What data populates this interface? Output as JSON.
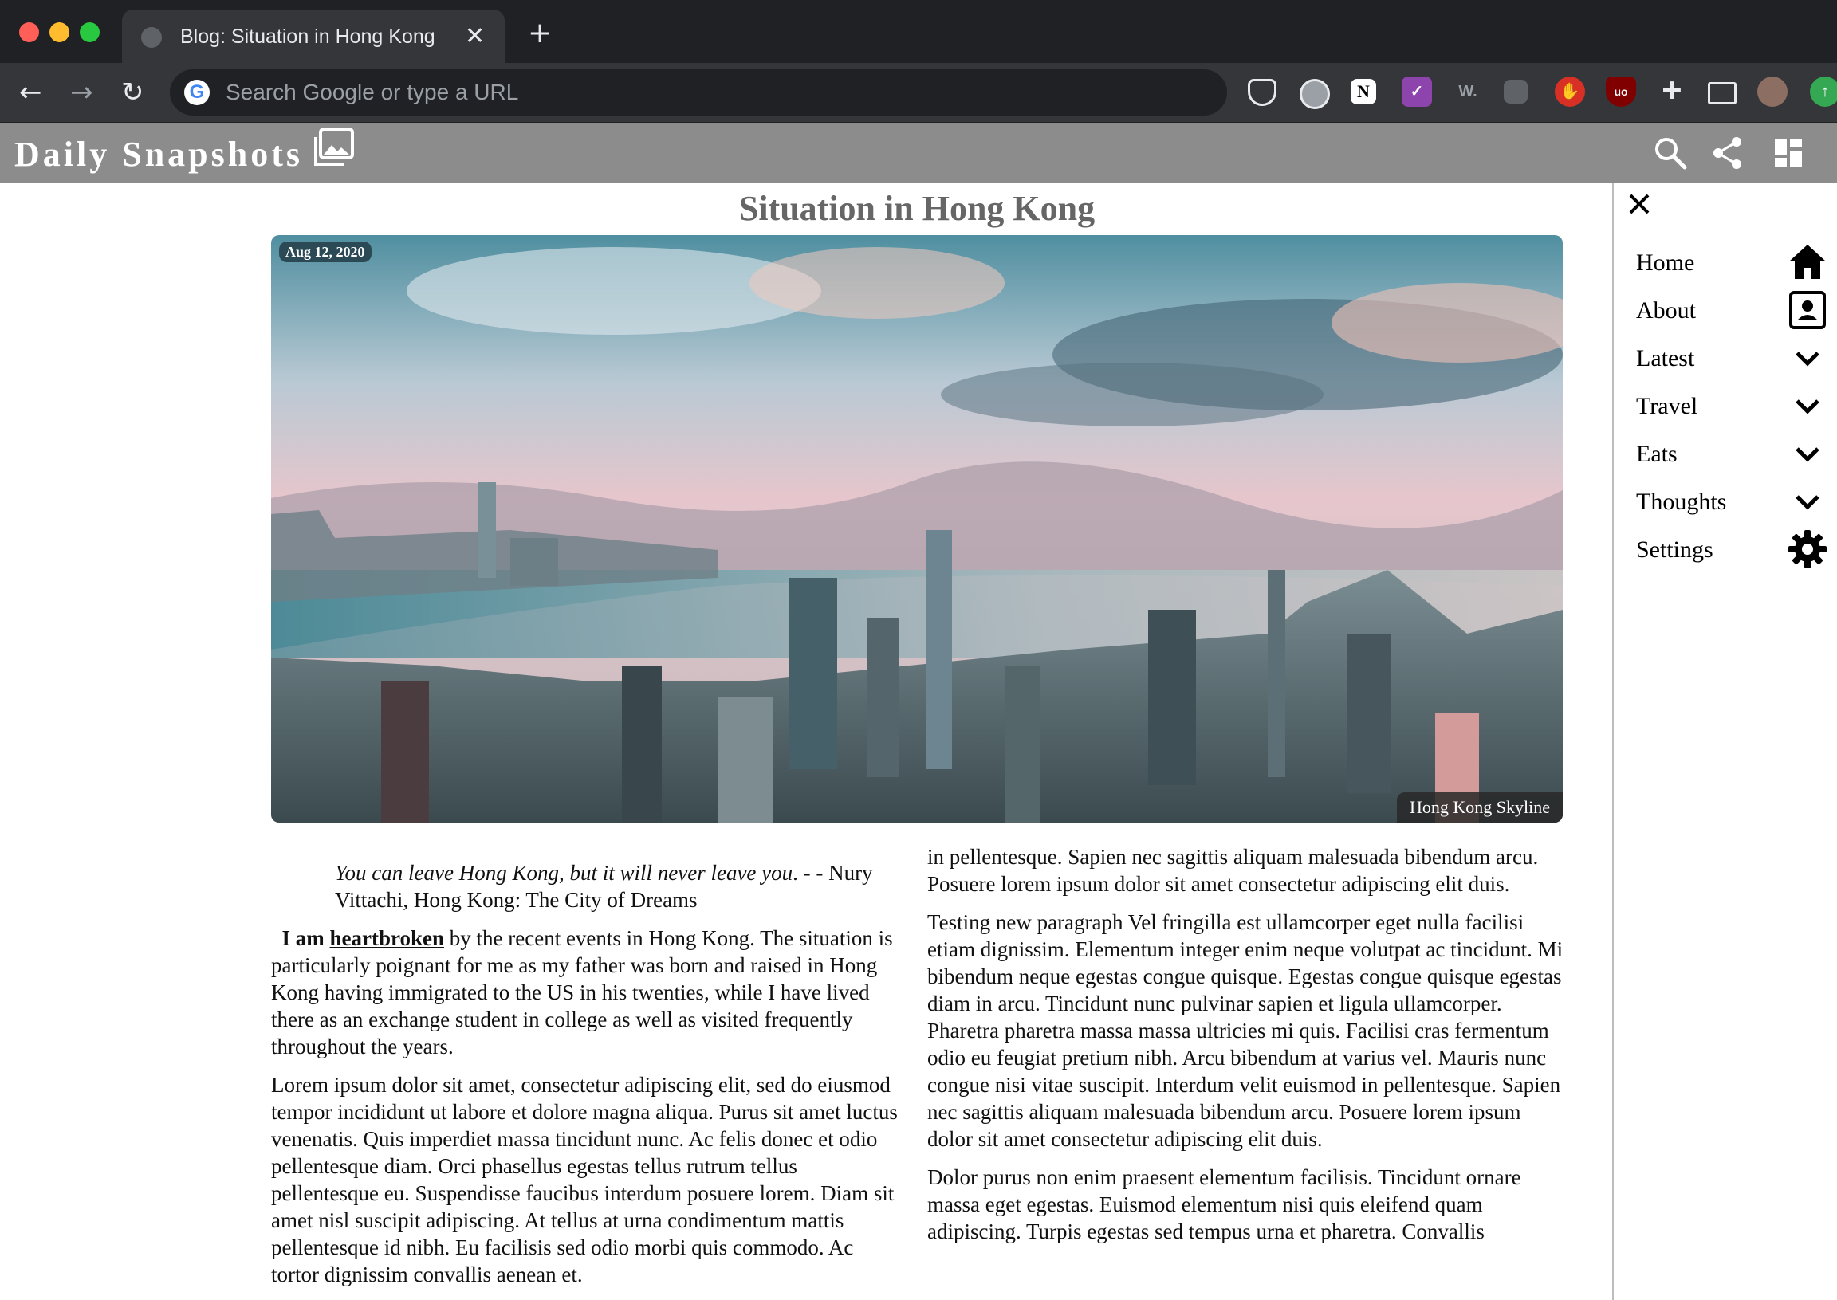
{
  "browser": {
    "tab_title": "Blog: Situation in Hong Kong",
    "omnibox_placeholder": "Search Google or type a URL",
    "extensions": [
      "pocket-icon",
      "circle-extension-icon",
      "notion-icon",
      "checklist-icon",
      "wordtune-icon",
      "office-icon",
      "stop-hand-icon",
      "ublock-icon",
      "puzzle-icon",
      "cast-icon",
      "profile-avatar",
      "update-icon"
    ]
  },
  "site": {
    "brand": "Daily Snapshots"
  },
  "article": {
    "title": "Situation in Hong Kong",
    "date": "Aug 12, 2020",
    "image_caption": "Hong Kong Skyline",
    "quote": {
      "text": "You can leave Hong Kong, but it will never leave you",
      "attribution": ". - - Nury Vittachi, Hong Kong: The City of Dreams"
    },
    "intro": {
      "lead": "I am",
      "link": "heartbroken",
      "rest": " by the recent events in Hong Kong. The situation is particularly poignant for me as my father was born and raised in Hong Kong having immigrated to the US in his twenties, while I have lived there as an exchange student in college as well as visited frequently throughout the years."
    },
    "left_paragraph": "Lorem ipsum dolor sit amet, consectetur adipiscing elit, sed do eiusmod tempor incididunt ut labore et dolore magna aliqua. Purus sit amet luctus venenatis. Quis imperdiet massa tincidunt nunc. Ac felis donec et odio pellentesque diam. Orci phasellus egestas tellus rutrum tellus pellentesque eu. Suspendisse faucibus interdum posuere lorem. Diam sit amet nisl suscipit adipiscing. At tellus at urna condimentum mattis pellentesque id nibh. Eu facilisis sed odio morbi quis commodo. Ac tortor dignissim convallis aenean et.",
    "right_paragraphs": [
      "in pellentesque. Sapien nec sagittis aliquam malesuada bibendum arcu. Posuere lorem ipsum dolor sit amet consectetur adipiscing elit duis.",
      "Testing new paragraph Vel fringilla est ullamcorper eget nulla facilisi etiam dignissim. Elementum integer enim neque volutpat ac tincidunt. Mi bibendum neque egestas congue quisque. Egestas congue quisque egestas diam in arcu. Tincidunt nunc pulvinar sapien et ligula ullamcorper. Pharetra pharetra massa massa ultricies mi quis. Facilisi cras fermentum odio eu feugiat pretium nibh. Arcu bibendum at varius vel. Mauris nunc congue nisi vitae suscipit. Interdum velit euismod in pellentesque. Sapien nec sagittis aliquam malesuada bibendum arcu. Posuere lorem ipsum dolor sit amet consectetur adipiscing elit duis.",
      "Dolor purus non enim praesent elementum facilisis. Tincidunt ornare massa eget egestas. Euismod elementum nisi quis eleifend quam adipiscing. Turpis egestas sed tempus urna et pharetra. Convallis"
    ]
  },
  "menu": {
    "items": [
      {
        "label": "Home",
        "icon": "home-icon"
      },
      {
        "label": "About",
        "icon": "contact-card-icon"
      },
      {
        "label": "Latest",
        "icon": "chevron-down-icon"
      },
      {
        "label": "Travel",
        "icon": "chevron-down-icon"
      },
      {
        "label": "Eats",
        "icon": "chevron-down-icon"
      },
      {
        "label": "Thoughts",
        "icon": "chevron-down-icon"
      },
      {
        "label": "Settings",
        "icon": "gear-icon"
      }
    ]
  }
}
